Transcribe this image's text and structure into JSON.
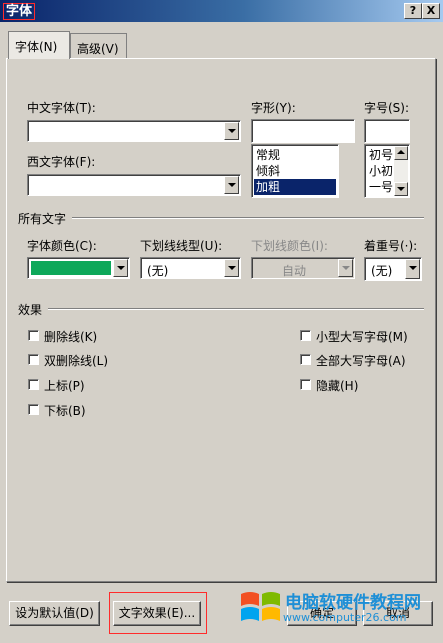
{
  "window": {
    "title": "字体",
    "help_button": "?",
    "close_button": "X"
  },
  "tabs": [
    {
      "label": "字体(N)"
    },
    {
      "label": "高级(V)"
    }
  ],
  "font": {
    "chinese_font_label": "中文字体(T):",
    "western_font_label": "西文字体(F):",
    "style_label": "字形(Y):",
    "size_label": "字号(S):",
    "style_options": [
      "常规",
      "倾斜",
      "加粗"
    ],
    "style_selected": "加粗",
    "size_options": [
      "初号",
      "小初",
      "一号"
    ]
  },
  "all_text": {
    "group_label": "所有文字",
    "font_color_label": "字体颜色(C):",
    "font_color_value": "#0ea85a",
    "underline_style_label": "下划线线型(U):",
    "underline_style_value": "(无)",
    "underline_color_label": "下划线颜色(I):",
    "underline_color_value": "自动",
    "emphasis_label": "着重号(·):",
    "emphasis_value": "(无)"
  },
  "effects": {
    "group_label": "效果",
    "left": [
      "删除线(K)",
      "双删除线(L)",
      "上标(P)",
      "下标(B)"
    ],
    "right": [
      "小型大写字母(M)",
      "全部大写字母(A)",
      "隐藏(H)"
    ]
  },
  "buttons": {
    "set_default": "设为默认值(D)",
    "text_effects": "文字效果(E)...",
    "ok": "确定",
    "cancel": "取消"
  },
  "watermark": {
    "line1": "电脑软硬件教程网",
    "line2": "www.computer26.com"
  }
}
